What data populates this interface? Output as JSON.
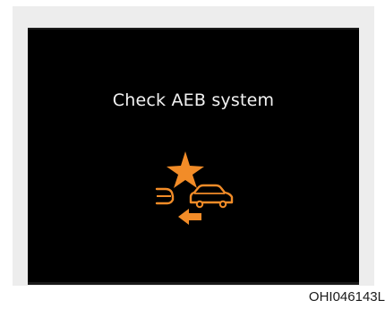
{
  "display": {
    "message": "Check AEB system",
    "warning_icon": "aeb-collision-warning-icon",
    "accent_color": "#f28c28",
    "background_color": "#000000"
  },
  "figure_code": "OHI046143L"
}
